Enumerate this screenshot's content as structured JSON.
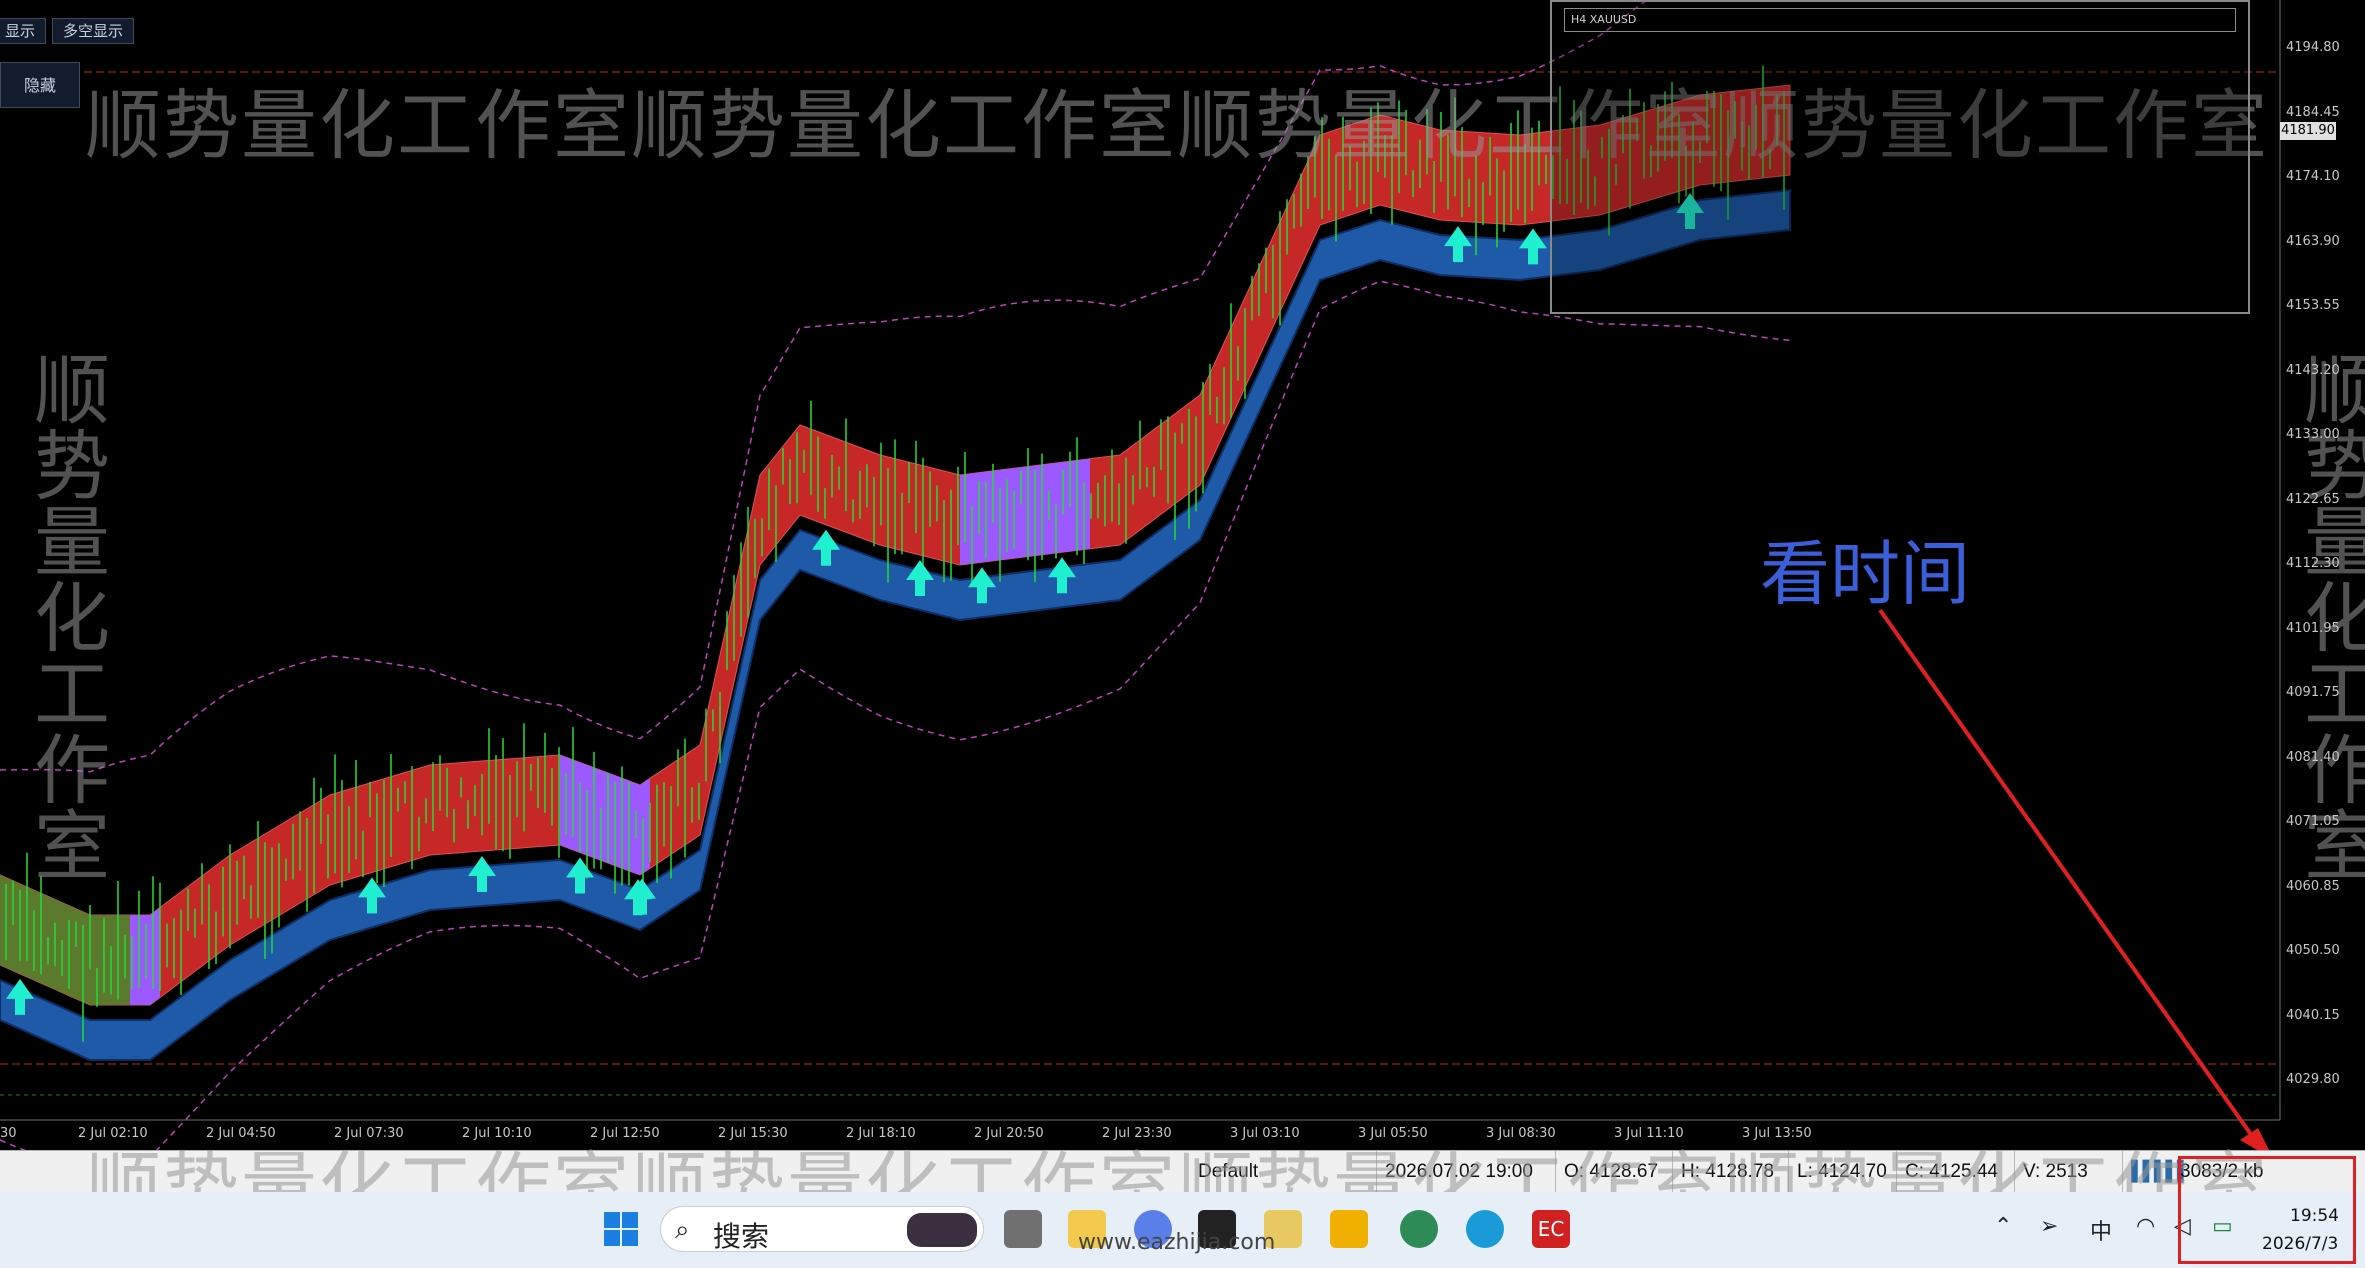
{
  "chart": {
    "top_buttons": [
      "显示",
      "多空显示"
    ],
    "hide_button": "隐藏",
    "watermark_horizontal": "顺势量化工作室顺势量化工作室顺势量化工作室顺势量化工作室",
    "watermark_vertical": "顺势量化工作室",
    "annotation": "看时间",
    "inset_title": "H4 XAUUSD",
    "current_price": "4181.90",
    "price_axis": [
      "4194.80",
      "4184.45",
      "4174.10",
      "4163.90",
      "4153.55",
      "4143.20",
      "4133.00",
      "4122.65",
      "4112.30",
      "4101.95",
      "4091.75",
      "4081.40",
      "4071.05",
      "4060.85",
      "4050.50",
      "4040.15",
      "4029.80"
    ],
    "time_axis": [
      "30",
      "2 Jul 02:10",
      "2 Jul 04:50",
      "2 Jul 07:30",
      "2 Jul 10:10",
      "2 Jul 12:50",
      "2 Jul 15:30",
      "2 Jul 18:10",
      "2 Jul 20:50",
      "2 Jul 23:30",
      "3 Jul 03:10",
      "3 Jul 05:50",
      "3 Jul 08:30",
      "3 Jul 11:10",
      "3 Jul 13:50"
    ],
    "colors": {
      "up_band": "#c62828",
      "buy_band": "#9b59ff",
      "support_band": "#1e5aa8",
      "support_band_edge": "#0d2f66",
      "green_band": "#5c7a2e",
      "candle": "#22dd33",
      "arrow": "#20f0d0",
      "envelope": "#c040c0",
      "annotation": "#3b5fd8",
      "highlight": "#e02020"
    }
  },
  "status_bar": {
    "profile": "Default",
    "datetime": "2026.07.02 19:00",
    "open": "O: 4128.67",
    "high": "H: 4128.78",
    "low": "L: 4124.70",
    "close": "C: 4125.44",
    "volume": "V: 2513",
    "traffic": "3083/2 kb"
  },
  "taskbar": {
    "search_label": "搜索",
    "site_watermark": "www.eazhijia.com",
    "input_method": "中",
    "time": "19:54",
    "date": "2026/7/3",
    "app_icons": [
      "windows-start",
      "task-view",
      "file-explorer",
      "copilot",
      "qq",
      "notepad",
      "mt4",
      "metatrader5",
      "edge",
      "ec"
    ]
  }
}
